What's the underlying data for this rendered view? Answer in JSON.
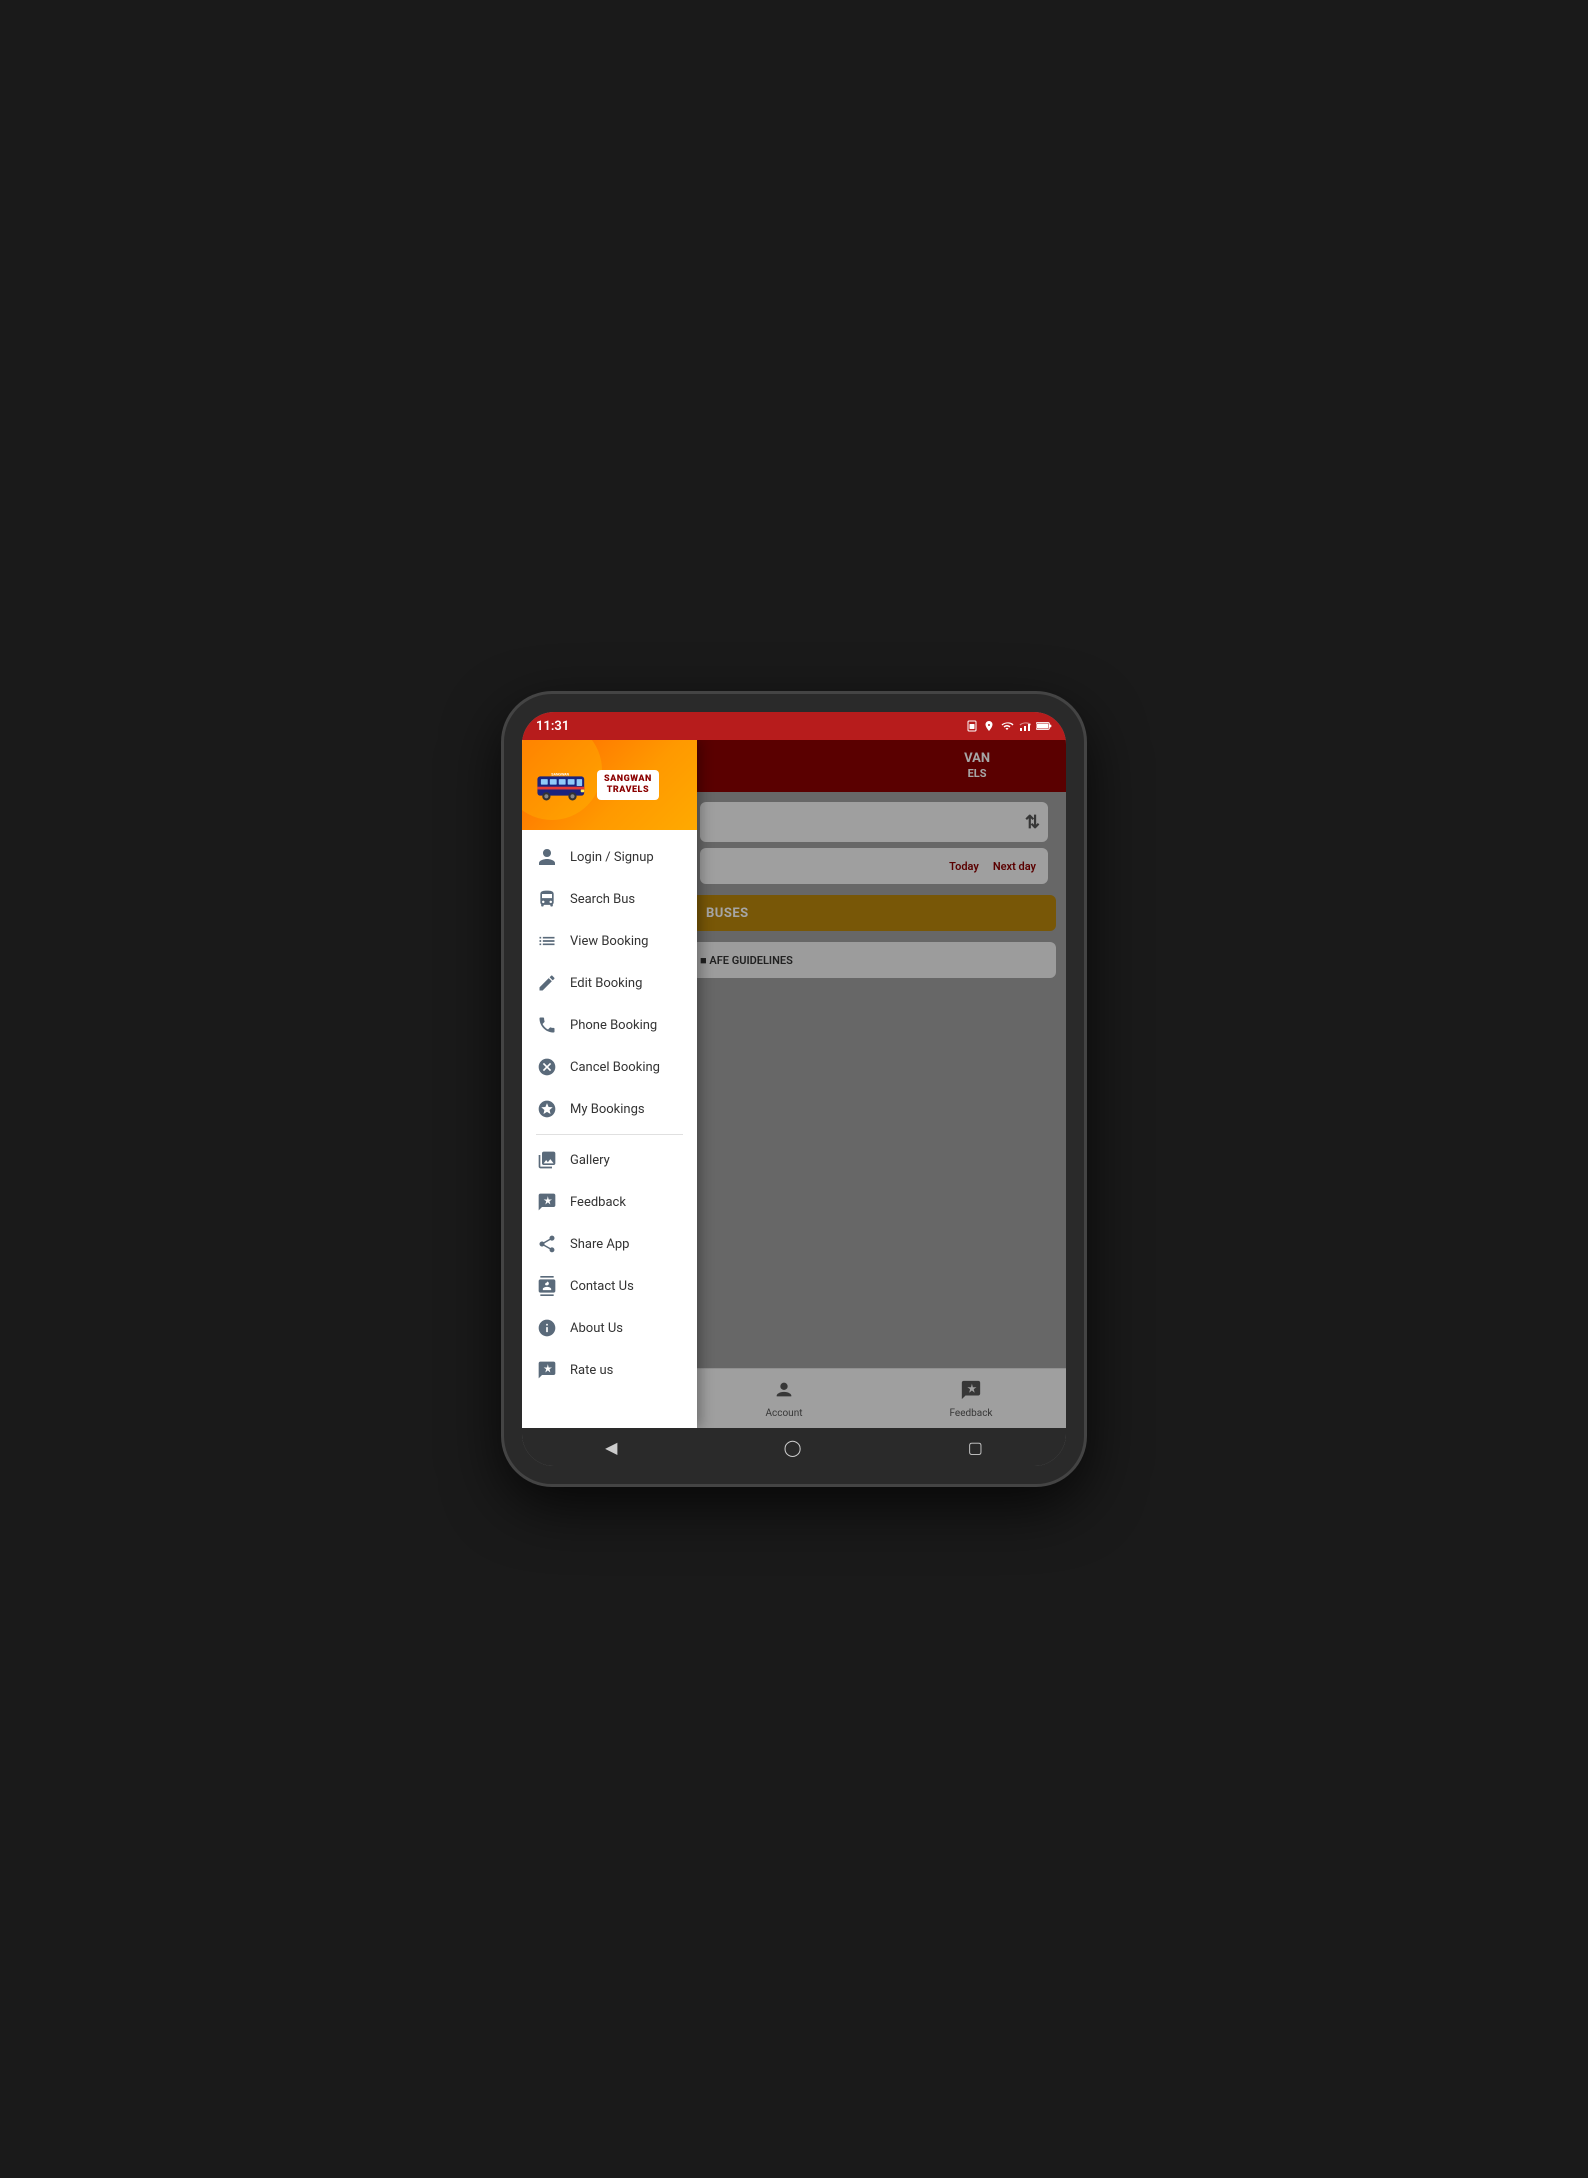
{
  "device": {
    "status_bar": {
      "time": "11:31",
      "icons": [
        "sim",
        "location",
        "wifi",
        "signal",
        "battery"
      ]
    }
  },
  "header": {
    "brand_line1": "SANGWAN",
    "brand_line2": "TRAVELS",
    "bg_title_line1": "VAN",
    "bg_title_line2": "ELS"
  },
  "bg_app": {
    "today_btn": "Today",
    "next_day_btn": "Next day",
    "buses_label": "BUSES",
    "safe_guidelines": "AFE GUIDELINES",
    "tab_account": "Account",
    "tab_feedback": "Feedback"
  },
  "drawer": {
    "menu_items": [
      {
        "id": "login-signup",
        "label": "Login / Signup",
        "icon": "person"
      },
      {
        "id": "search-bus",
        "label": "Search Bus",
        "icon": "bus"
      },
      {
        "id": "view-booking",
        "label": "View Booking",
        "icon": "list"
      },
      {
        "id": "edit-booking",
        "label": "Edit Booking",
        "icon": "edit"
      },
      {
        "id": "phone-booking",
        "label": "Phone Booking",
        "icon": "phone"
      },
      {
        "id": "cancel-booking",
        "label": "Cancel Booking",
        "icon": "cancel"
      },
      {
        "id": "my-bookings",
        "label": "My Bookings",
        "icon": "star"
      }
    ],
    "section2_items": [
      {
        "id": "gallery",
        "label": "Gallery",
        "icon": "gallery"
      },
      {
        "id": "feedback",
        "label": "Feedback",
        "icon": "feedback"
      },
      {
        "id": "share-app",
        "label": "Share App",
        "icon": "share"
      },
      {
        "id": "contact-us",
        "label": "Contact Us",
        "icon": "contact"
      },
      {
        "id": "about-us",
        "label": "About Us",
        "icon": "info"
      },
      {
        "id": "rate-us",
        "label": "Rate us",
        "icon": "rate"
      }
    ]
  }
}
